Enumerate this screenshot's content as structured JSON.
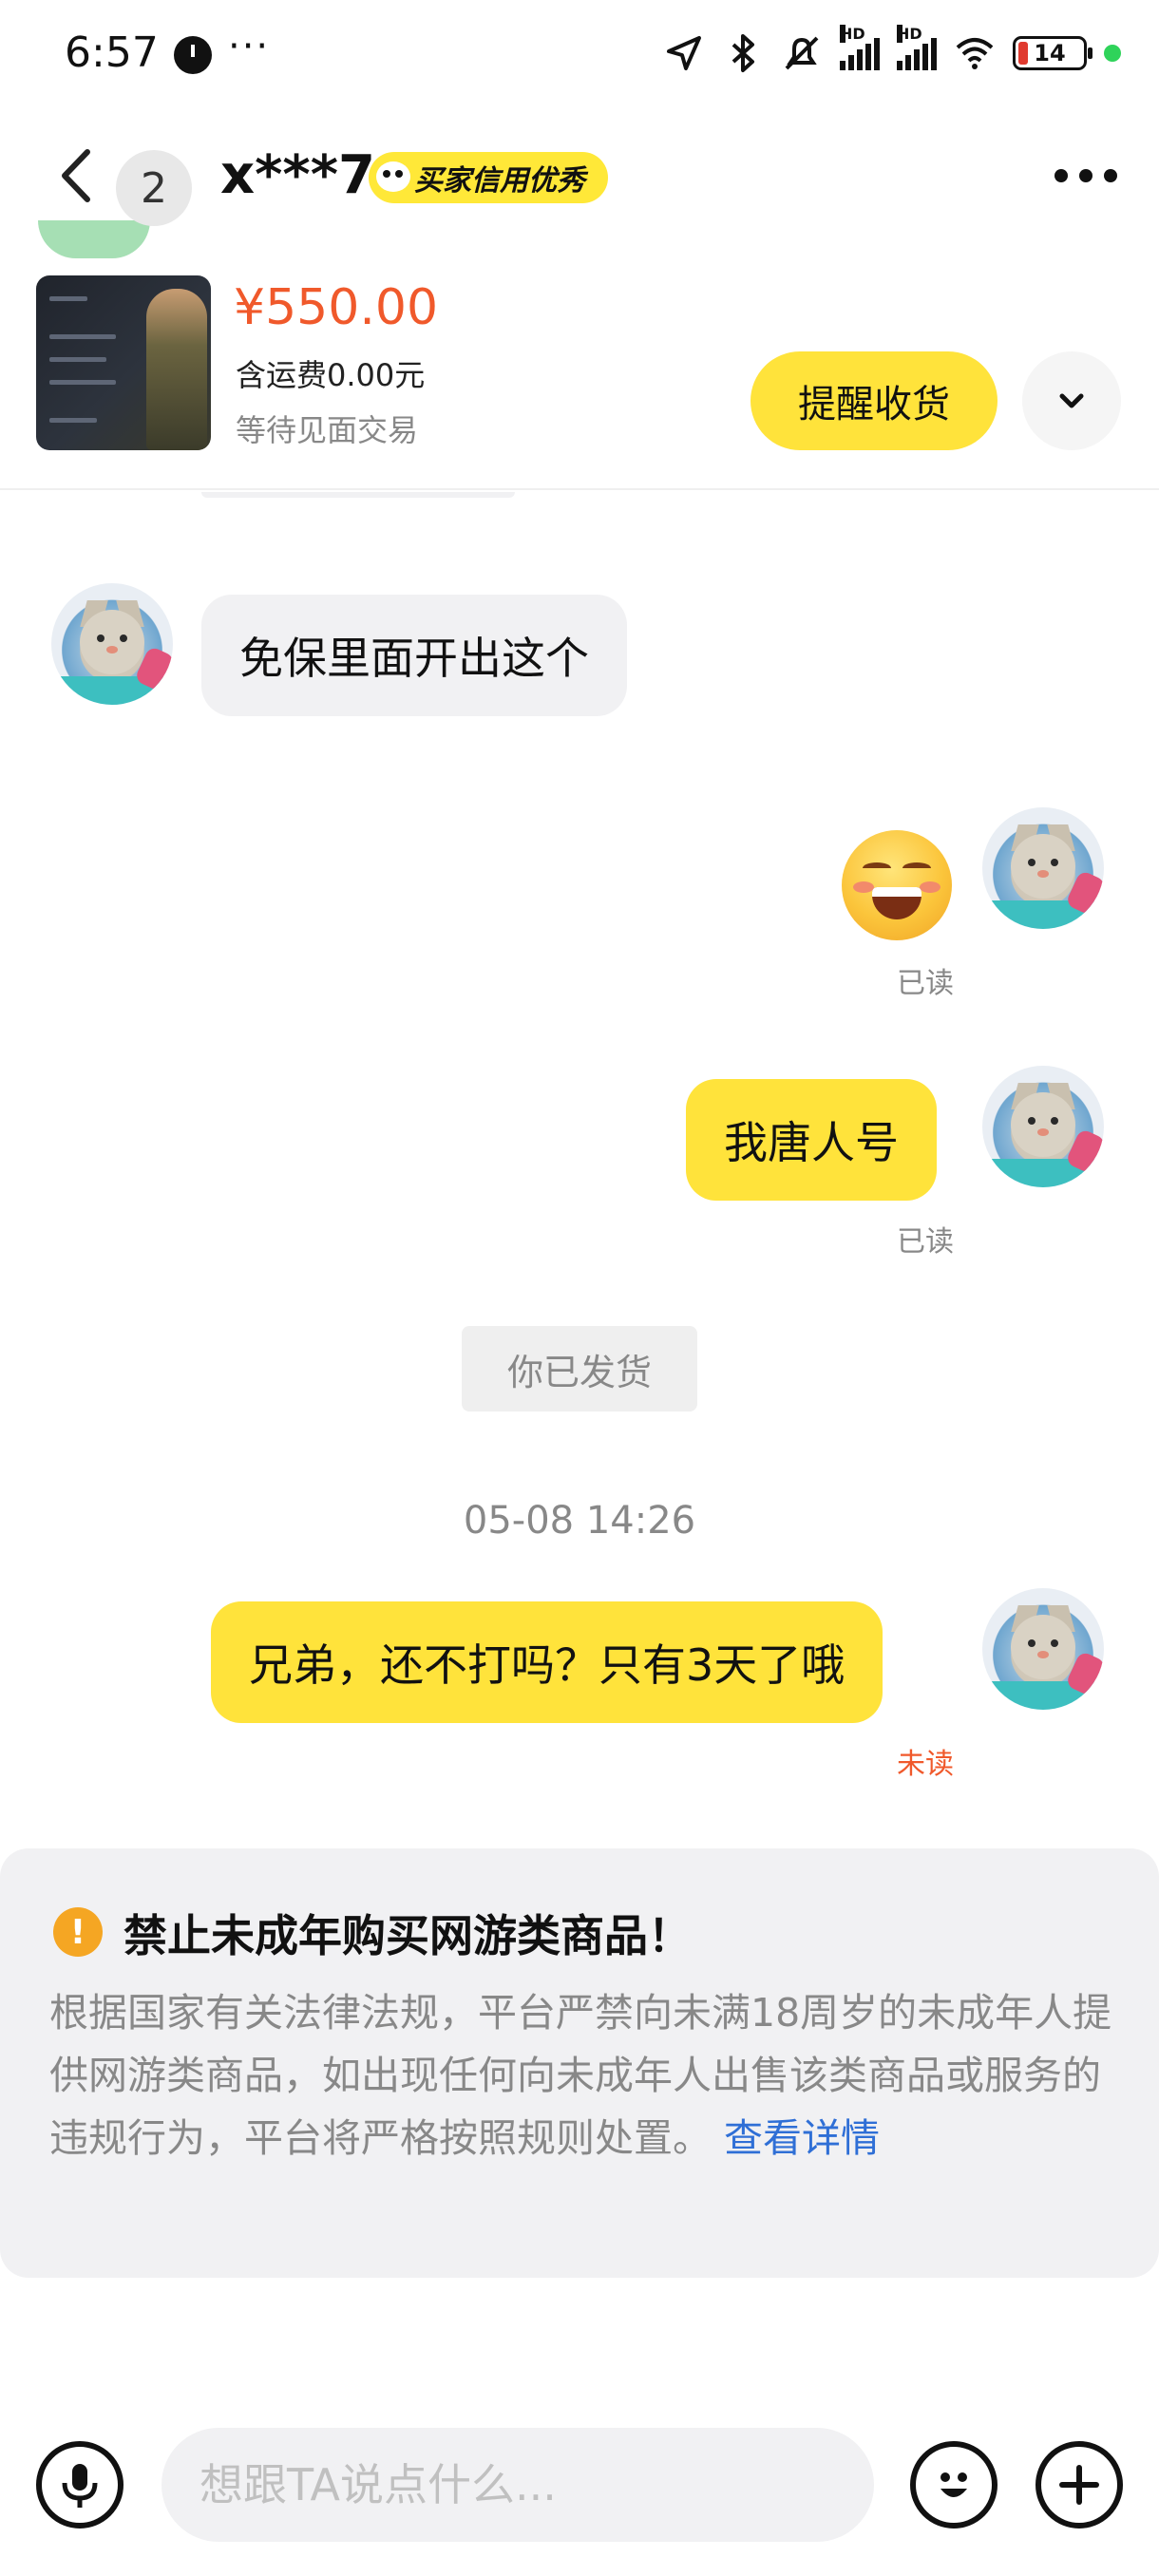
{
  "status_bar": {
    "time": "6:57",
    "more": "···",
    "battery": "14"
  },
  "header": {
    "unread_count": "2",
    "user_name": "x***7",
    "credit_badge": "买家信用优秀"
  },
  "product": {
    "price": "¥550.00",
    "shipping": "含运费0.00元",
    "status": "等待见面交易",
    "remind_button": "提醒收货"
  },
  "messages": [
    {
      "side": "left",
      "text": "免保里面开出这个"
    },
    {
      "side": "right",
      "type": "emoji",
      "icon": "grinning-face-icon",
      "read": "已读"
    },
    {
      "side": "right",
      "text": "我唐人号",
      "read": "已读"
    },
    {
      "side": "system",
      "text": "你已发货"
    },
    {
      "side": "timestamp",
      "text": "05-08 14:26"
    },
    {
      "side": "right",
      "text": "兄弟，还不打吗？只有3天了哦",
      "read": "未读"
    }
  ],
  "notice": {
    "icon": "!",
    "title": "禁止未成年购买网游类商品！",
    "body": "根据国家有关法律法规，平台严禁向未满18周岁的未成年人提供网游类商品，如出现任何向未成年人出售该类商品或服务的违规行为，平台将严格按照规则处置。",
    "link": "查看详情"
  },
  "input": {
    "placeholder": "想跟TA说点什么..."
  },
  "colors": {
    "accent_yellow": "#ffe33b",
    "price_orange": "#f0592b",
    "link_blue": "#2f6fd6"
  }
}
